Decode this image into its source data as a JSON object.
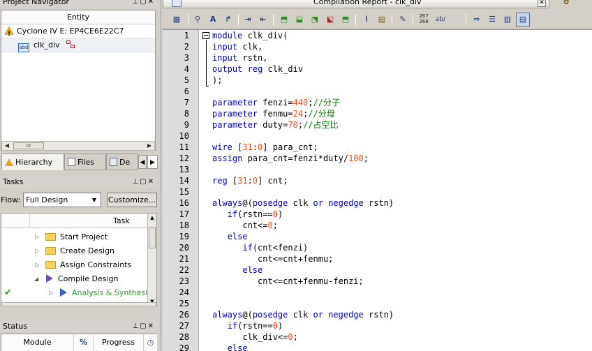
{
  "left_panel": {
    "project_navigator": {
      "title": "Project Navigator",
      "column_header": "Entity",
      "device": "Cyclone IV E: EP4CE6E22C7",
      "entity": "clk_div",
      "entity_icon_text": "abd",
      "scroll_thumb": "III"
    },
    "tabs": [
      {
        "label": "Hierarchy"
      },
      {
        "label": "Files"
      },
      {
        "label": "De"
      }
    ],
    "tasks": {
      "title": "Tasks",
      "flow_label": "Flow:",
      "flow_value": "Full Design",
      "customize_label": "Customize...",
      "column_header": "Task",
      "items": [
        {
          "label": "Start Project",
          "icon": "folder-icon"
        },
        {
          "label": "Create Design",
          "icon": "folder-icon"
        },
        {
          "label": "Assign Constraints",
          "icon": "folder-icon"
        },
        {
          "label": "Compile Design",
          "icon": "play-icon"
        },
        {
          "label": "Analysis & Synthesis",
          "icon": "play-icon",
          "status": "done",
          "highlight_color": "#2a9a2a"
        }
      ]
    },
    "status": {
      "title": "Status",
      "columns": [
        "Module",
        "%",
        "Progress"
      ]
    }
  },
  "editor": {
    "tab_title": "Compilation Report - clk_div",
    "toolbar_small_label": "267\n268",
    "toolbar_ab_label": "ab/",
    "lines": [
      {
        "n": "1",
        "tokens": [
          [
            "kw",
            "module"
          ],
          [
            "plain",
            " clk_div("
          ]
        ]
      },
      {
        "n": "2",
        "tokens": [
          [
            "kw",
            "input"
          ],
          [
            "plain",
            " clk,"
          ]
        ]
      },
      {
        "n": "3",
        "tokens": [
          [
            "kw",
            "input"
          ],
          [
            "plain",
            " rstn,"
          ]
        ]
      },
      {
        "n": "4",
        "tokens": [
          [
            "kw",
            "output reg"
          ],
          [
            "plain",
            " clk_div"
          ]
        ]
      },
      {
        "n": "5",
        "tokens": [
          [
            "plain",
            ");"
          ]
        ]
      },
      {
        "n": "6",
        "tokens": []
      },
      {
        "n": "7",
        "tokens": [
          [
            "kw",
            "parameter"
          ],
          [
            "plain",
            " fenzi="
          ],
          [
            "num",
            "440"
          ],
          [
            "plain",
            ";"
          ],
          [
            "cmt",
            "//分子"
          ]
        ]
      },
      {
        "n": "8",
        "tokens": [
          [
            "kw",
            "parameter"
          ],
          [
            "plain",
            " fenmu="
          ],
          [
            "num",
            "24"
          ],
          [
            "plain",
            ";"
          ],
          [
            "cmt",
            "//分母"
          ]
        ]
      },
      {
        "n": "9",
        "tokens": [
          [
            "kw",
            "parameter"
          ],
          [
            "plain",
            " duty="
          ],
          [
            "num",
            "70"
          ],
          [
            "plain",
            ";"
          ],
          [
            "cmt",
            "//占空比"
          ]
        ]
      },
      {
        "n": "10",
        "tokens": []
      },
      {
        "n": "11",
        "tokens": [
          [
            "kw",
            "wire"
          ],
          [
            "plain",
            " ["
          ],
          [
            "num",
            "31"
          ],
          [
            "plain",
            ":"
          ],
          [
            "num",
            "0"
          ],
          [
            "plain",
            "] para_cnt;"
          ]
        ]
      },
      {
        "n": "12",
        "tokens": [
          [
            "kw",
            "assign"
          ],
          [
            "plain",
            " para_cnt=fenzi*duty/"
          ],
          [
            "num",
            "100"
          ],
          [
            "plain",
            ";"
          ]
        ]
      },
      {
        "n": "13",
        "tokens": []
      },
      {
        "n": "14",
        "tokens": [
          [
            "kw",
            "reg"
          ],
          [
            "plain",
            " ["
          ],
          [
            "num",
            "31"
          ],
          [
            "plain",
            ":"
          ],
          [
            "num",
            "0"
          ],
          [
            "plain",
            "] cnt;"
          ]
        ]
      },
      {
        "n": "15",
        "tokens": []
      },
      {
        "n": "16",
        "tokens": [
          [
            "kw",
            "always"
          ],
          [
            "plain",
            "@("
          ],
          [
            "kw",
            "posedge"
          ],
          [
            "plain",
            " clk "
          ],
          [
            "kw",
            "or"
          ],
          [
            "plain",
            " "
          ],
          [
            "kw",
            "negedge"
          ],
          [
            "plain",
            " rstn)"
          ]
        ]
      },
      {
        "n": "17",
        "tokens": [
          [
            "plain",
            "   "
          ],
          [
            "kw",
            "if"
          ],
          [
            "plain",
            "(rstn=="
          ],
          [
            "num",
            "0"
          ],
          [
            "plain",
            ")"
          ]
        ]
      },
      {
        "n": "18",
        "tokens": [
          [
            "plain",
            "      cnt<="
          ],
          [
            "num",
            "0"
          ],
          [
            "plain",
            ";"
          ]
        ]
      },
      {
        "n": "19",
        "tokens": [
          [
            "plain",
            "   "
          ],
          [
            "kw",
            "else"
          ]
        ]
      },
      {
        "n": "20",
        "tokens": [
          [
            "plain",
            "      "
          ],
          [
            "kw",
            "if"
          ],
          [
            "plain",
            "(cnt<fenzi)"
          ]
        ]
      },
      {
        "n": "21",
        "tokens": [
          [
            "plain",
            "         cnt<=cnt+fenmu;"
          ]
        ]
      },
      {
        "n": "22",
        "tokens": [
          [
            "plain",
            "      "
          ],
          [
            "kw",
            "else"
          ]
        ]
      },
      {
        "n": "23",
        "tokens": [
          [
            "plain",
            "         cnt<=cnt+fenmu-fenzi;"
          ]
        ]
      },
      {
        "n": "24",
        "tokens": []
      },
      {
        "n": "25",
        "tokens": []
      },
      {
        "n": "26",
        "tokens": [
          [
            "kw",
            "always"
          ],
          [
            "plain",
            "@("
          ],
          [
            "kw",
            "posedge"
          ],
          [
            "plain",
            " clk "
          ],
          [
            "kw",
            "or"
          ],
          [
            "plain",
            " "
          ],
          [
            "kw",
            "negedge"
          ],
          [
            "plain",
            " rstn)"
          ]
        ]
      },
      {
        "n": "27",
        "tokens": [
          [
            "plain",
            "   "
          ],
          [
            "kw",
            "if"
          ],
          [
            "plain",
            "(rstn=="
          ],
          [
            "num",
            "0"
          ],
          [
            "plain",
            ")"
          ]
        ]
      },
      {
        "n": "28",
        "tokens": [
          [
            "plain",
            "      clk_div<="
          ],
          [
            "num",
            "0"
          ],
          [
            "plain",
            ";"
          ]
        ]
      },
      {
        "n": "29",
        "tokens": [
          [
            "plain",
            "   "
          ],
          [
            "kw",
            "else"
          ]
        ]
      }
    ]
  },
  "colors": {
    "keyword": "#0000c8",
    "number": "#ff4a1a",
    "comment": "#008000",
    "gutter": "#dcdcdc",
    "panel_bg": "#d4d0c8"
  }
}
